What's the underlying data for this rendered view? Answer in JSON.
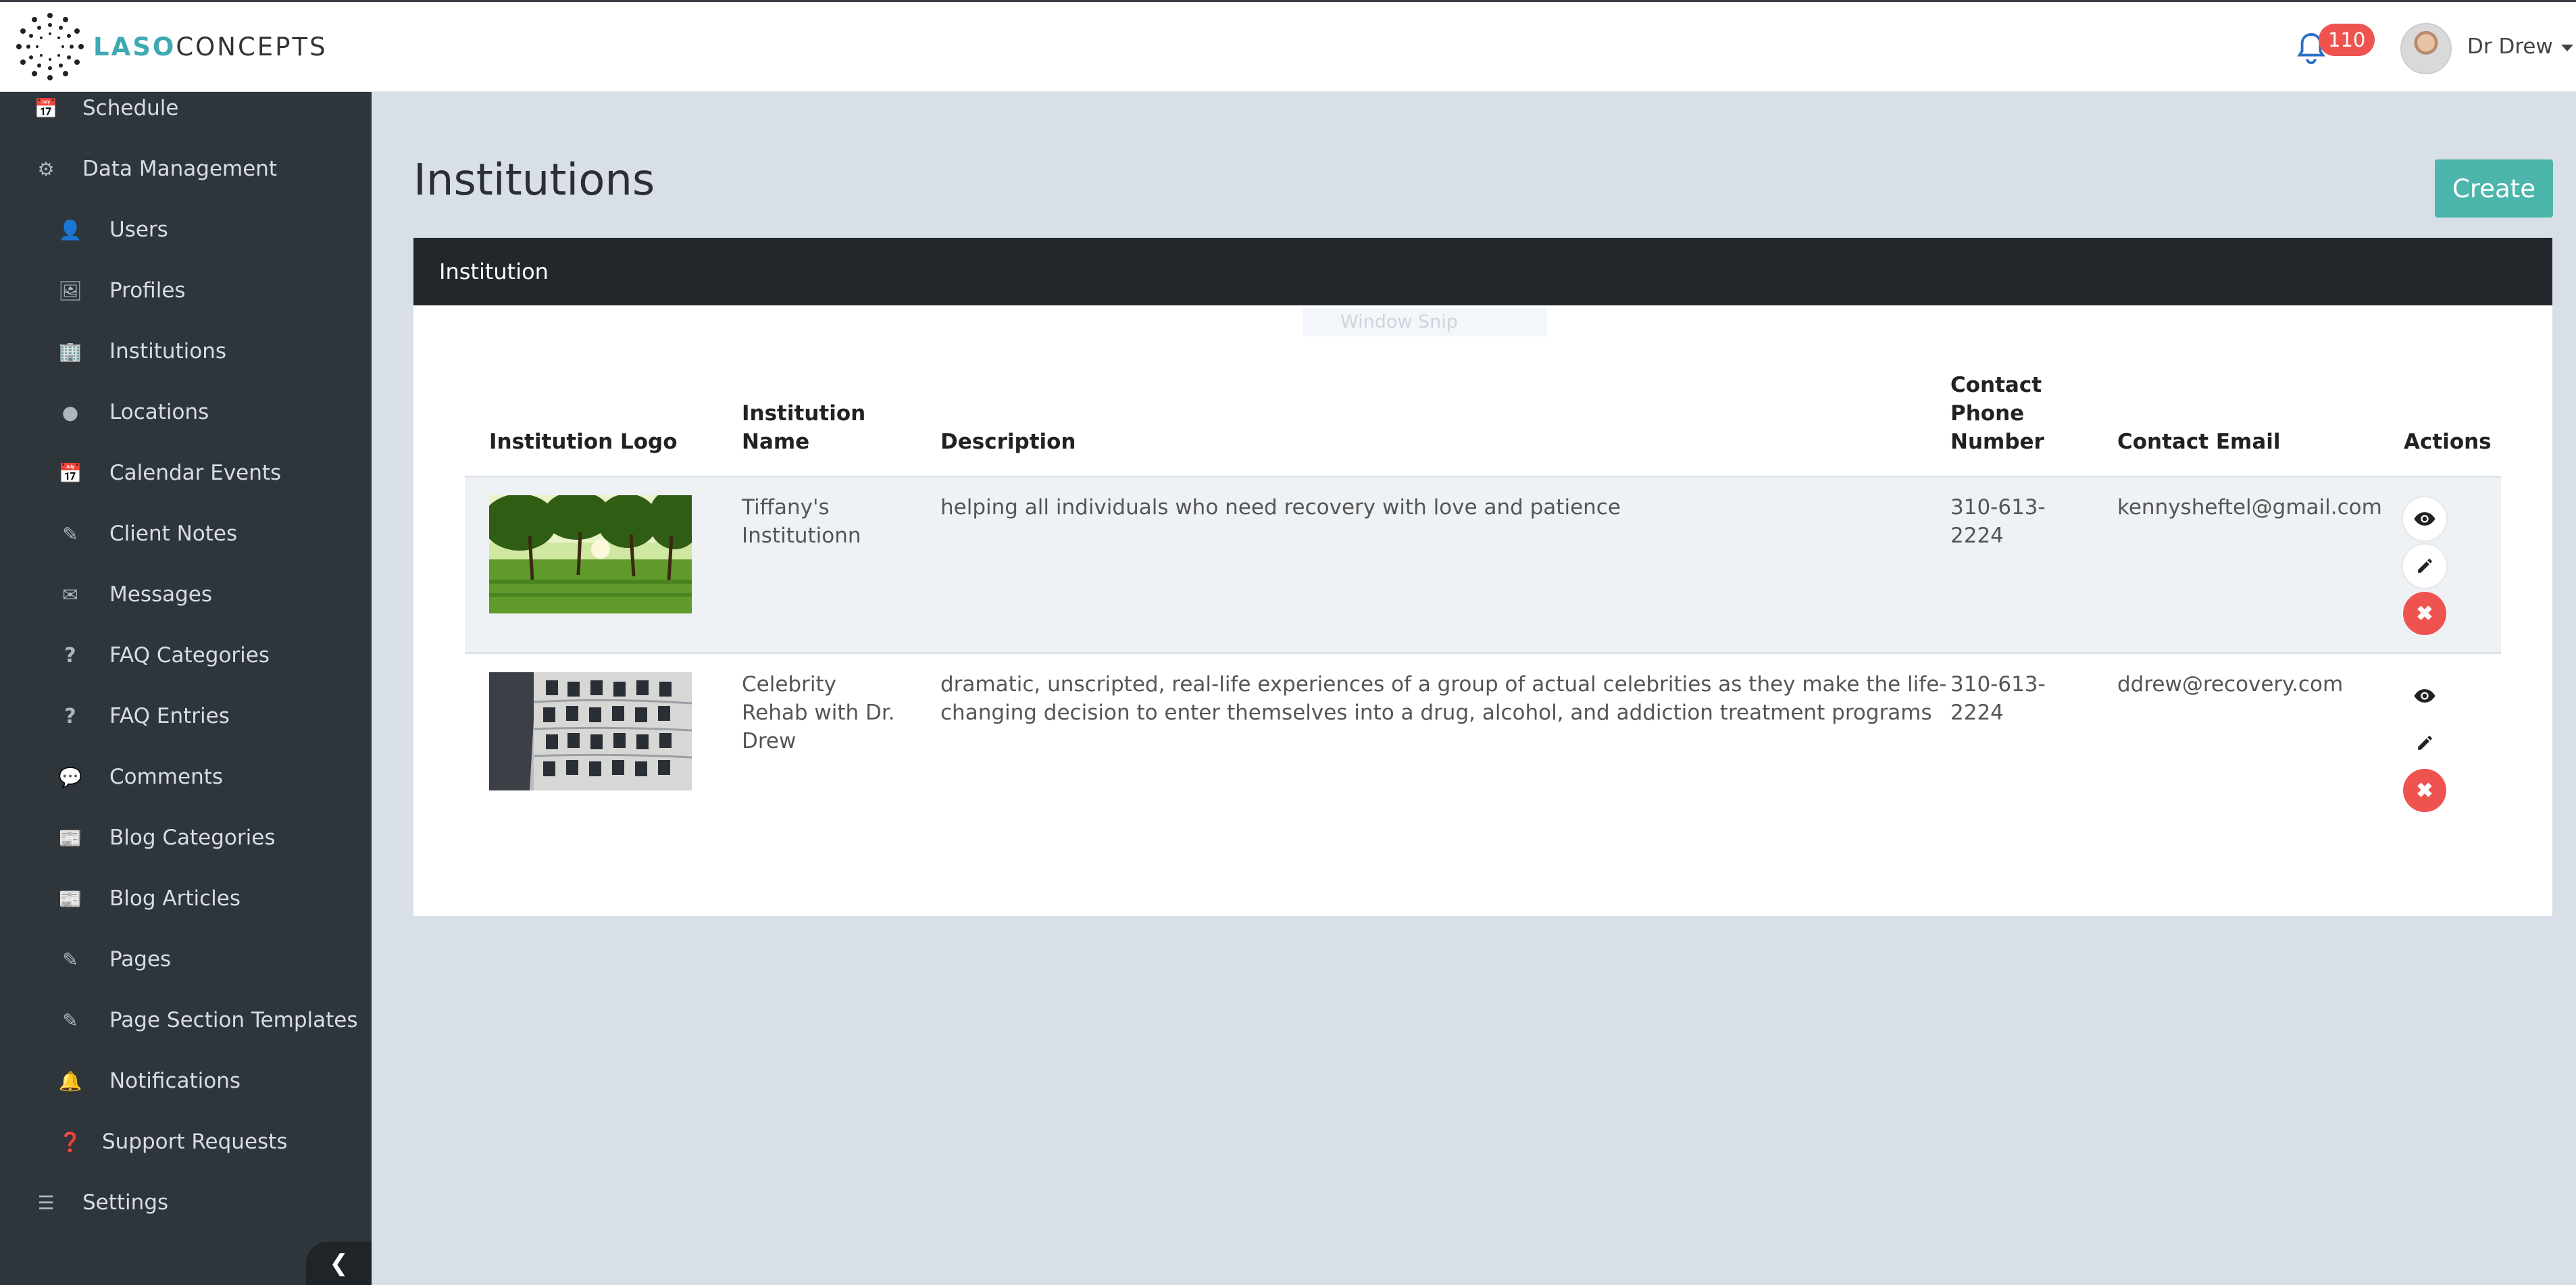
{
  "header": {
    "logo_text_accent": "LASO",
    "logo_text_rest": "CONCEPTS",
    "notification_count": "110",
    "user_name": "Dr Drew"
  },
  "sidebar": {
    "items": [
      {
        "label": "Schedule",
        "icon": "calendar-icon"
      },
      {
        "label": "Data Management",
        "icon": "gear-icon"
      },
      {
        "label": "Users",
        "icon": "user-icon"
      },
      {
        "label": "Profiles",
        "icon": "image-icon"
      },
      {
        "label": "Institutions",
        "icon": "building-icon"
      },
      {
        "label": "Locations",
        "icon": "map-marker-icon"
      },
      {
        "label": "Calendar Events",
        "icon": "calendar-icon"
      },
      {
        "label": "Client Notes",
        "icon": "edit-icon"
      },
      {
        "label": "Messages",
        "icon": "envelope-icon"
      },
      {
        "label": "FAQ Categories",
        "icon": "question-icon"
      },
      {
        "label": "FAQ Entries",
        "icon": "question-icon"
      },
      {
        "label": "Comments",
        "icon": "comments-icon"
      },
      {
        "label": "Blog Categories",
        "icon": "newspaper-icon"
      },
      {
        "label": "Blog Articles",
        "icon": "newspaper-icon"
      },
      {
        "label": "Pages",
        "icon": "edit-icon"
      },
      {
        "label": "Page Section Templates",
        "icon": "edit-icon"
      },
      {
        "label": "Notifications",
        "icon": "bell-icon"
      },
      {
        "label": "Support Requests",
        "icon": "question-circle-icon"
      },
      {
        "label": "Settings",
        "icon": "sliders-icon"
      }
    ],
    "collapse_icon": "chevron-left-icon"
  },
  "main": {
    "title": "Institutions",
    "create_label": "Create",
    "card_title": "Institution",
    "overlay_text": "Window Snip",
    "columns": {
      "logo": "Institution Logo",
      "name_1": "Institution",
      "name_2": "Name",
      "description": "Description",
      "phone_1": "Contact",
      "phone_2": "Phone",
      "phone_3": "Number",
      "email": "Contact Email",
      "actions": "Actions"
    },
    "rows": [
      {
        "name_lines": [
          "Tiffany's",
          "Institutionn"
        ],
        "description_lines": [
          "helping all individuals who need recovery with love and patience"
        ],
        "phone_lines": [
          "310-613-",
          "2224"
        ],
        "email": "kennysheftel@gmail.com",
        "logo": "park-trees-photo"
      },
      {
        "name_lines": [
          "Celebrity",
          "Rehab with Dr.",
          "Drew"
        ],
        "description_lines": [
          "dramatic, unscripted, real-life experiences of a group of actual celebrities as they make the life-",
          "changing decision to enter themselves into a drug, alcohol, and addiction treatment programs"
        ],
        "phone_lines": [
          "310-613-",
          "2224"
        ],
        "email": "ddrew@recovery.com",
        "logo": "building-facade-photo"
      }
    ],
    "action_icons": [
      "eye-icon",
      "pencil-icon",
      "times-icon"
    ]
  },
  "colors": {
    "sidebar_bg": "#2e353b",
    "page_bg": "#d9dfe6",
    "accent": "#4db6ac",
    "danger": "#ef5350"
  }
}
